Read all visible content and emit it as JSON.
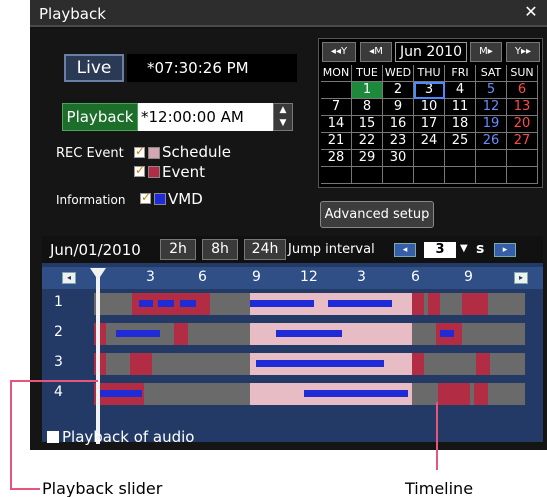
{
  "window": {
    "title": "Playback"
  },
  "live": {
    "label": "Live",
    "time": "*07:30:26 PM"
  },
  "playback": {
    "label": "Playback",
    "time": "*12:00:00 AM"
  },
  "rec_event": {
    "label": "REC Event",
    "schedule_label": "Schedule",
    "event_label": "Event"
  },
  "information": {
    "label": "Information",
    "vmd_label": "VMD"
  },
  "colors": {
    "schedule": "#d3a6b1",
    "event": "#b22d43",
    "vmd": "#1e2bd6",
    "recorded": "#e8bcc4"
  },
  "calendar": {
    "prev_year": "◂◂Y",
    "prev_month": "◂M",
    "month": "Jun 2010",
    "next_month": "M▸",
    "next_year": "Y▸▸",
    "weekdays": [
      "MON",
      "TUE",
      "WED",
      "THU",
      "FRI",
      "SAT",
      "SUN"
    ],
    "weeks": [
      [
        "",
        "1",
        "2",
        "3",
        "4",
        "5",
        "6"
      ],
      [
        "7",
        "8",
        "9",
        "10",
        "11",
        "12",
        "13"
      ],
      [
        "14",
        "15",
        "16",
        "17",
        "18",
        "19",
        "20"
      ],
      [
        "21",
        "22",
        "23",
        "24",
        "25",
        "26",
        "27"
      ],
      [
        "28",
        "29",
        "30",
        "",
        "",
        "",
        ""
      ],
      [
        "",
        "",
        "",
        "",
        "",
        "",
        ""
      ]
    ]
  },
  "advanced_setup": "Advanced setup",
  "timeline": {
    "date": "Jun/01/2010",
    "zoom": [
      "2h",
      "8h",
      "24h"
    ],
    "jump_label": "Jump interval",
    "jump_value": "3",
    "jump_unit": "s",
    "prev_arrow": "◂",
    "next_arrow": "▸",
    "ticks": [
      "3",
      "6",
      "9",
      "12",
      "3",
      "6",
      "9"
    ],
    "cameras": [
      "1",
      "2",
      "3",
      "4"
    ]
  },
  "audio": {
    "label": "Playback of audio"
  },
  "callouts": {
    "slider": "Playback slider",
    "timeline": "Timeline"
  }
}
